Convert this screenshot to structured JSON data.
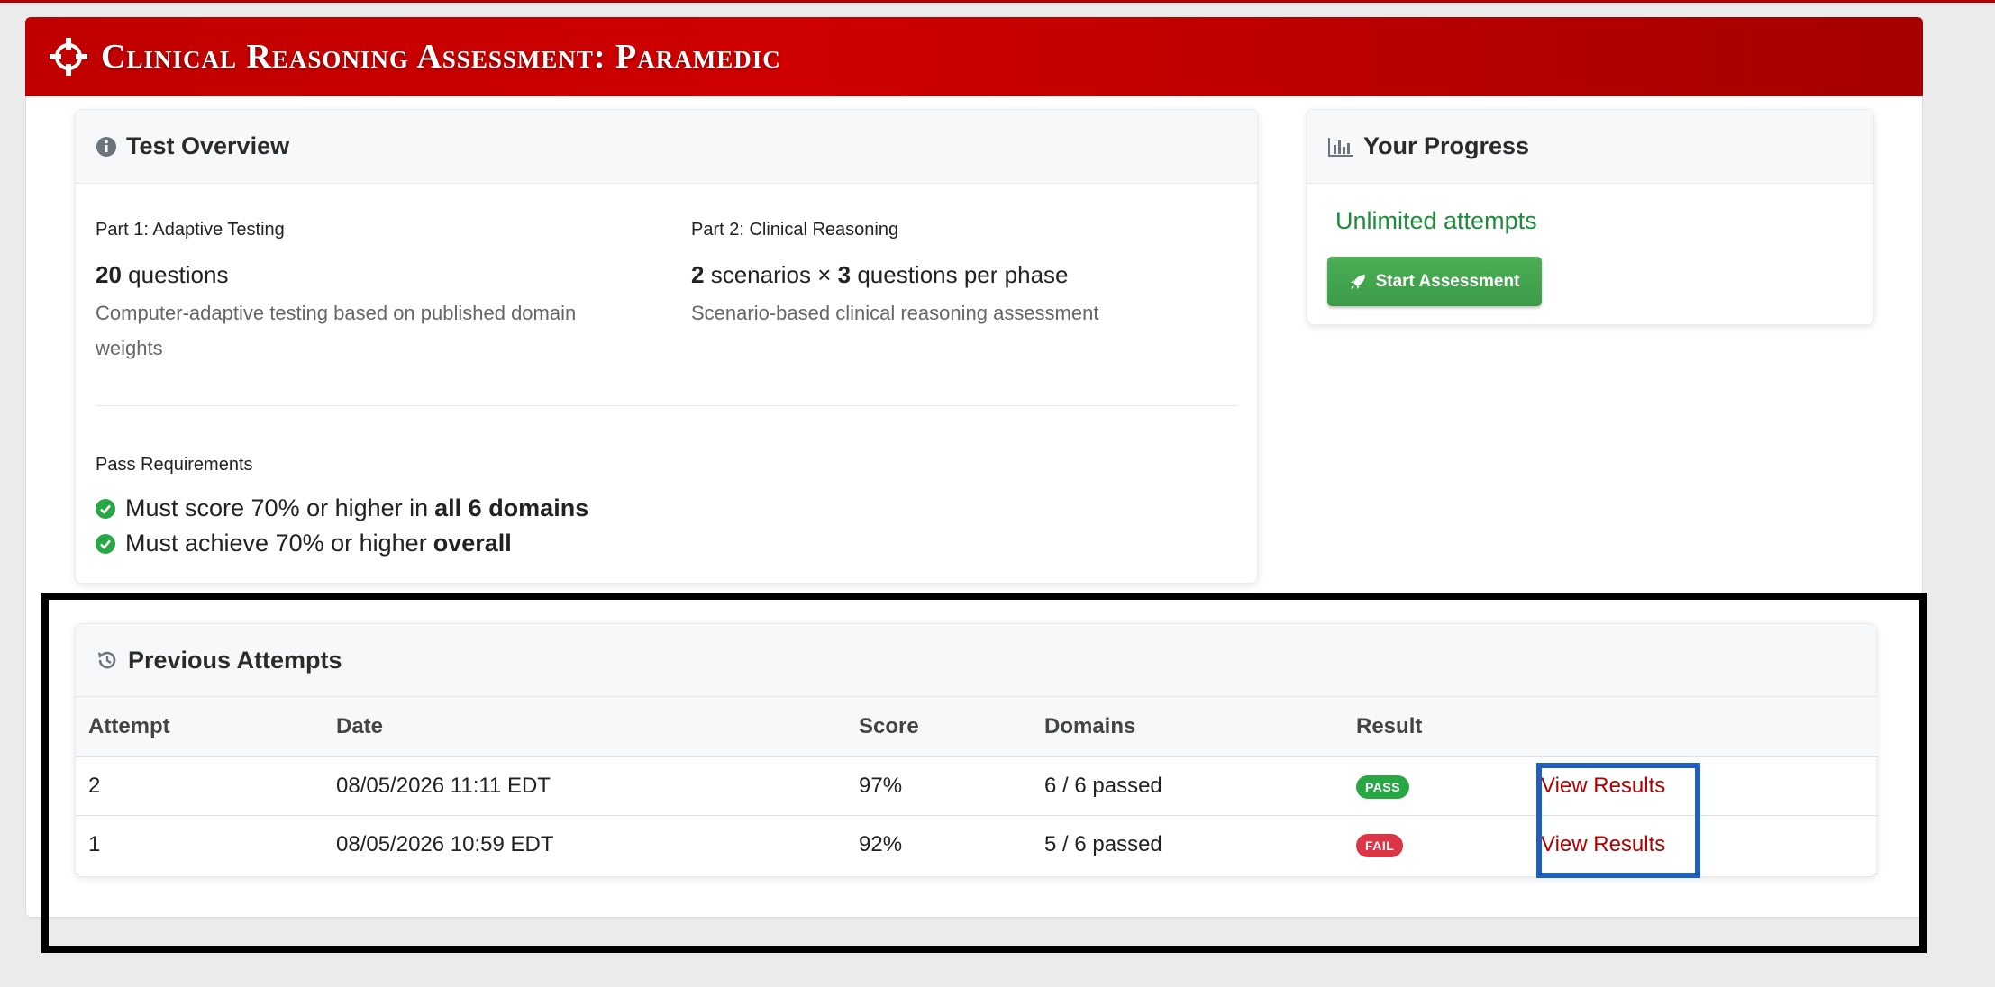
{
  "header": {
    "title": "Clinical Reasoning Assessment: Paramedic"
  },
  "overview": {
    "title": "Test Overview",
    "part1": {
      "label": "Part 1: Adaptive Testing",
      "count": "20",
      "count_suffix": "questions",
      "description": "Computer-adaptive testing based on published domain weights"
    },
    "part2": {
      "label": "Part 2: Clinical Reasoning",
      "scenarios": "2",
      "scenarios_text": "scenarios ×",
      "questions": "3",
      "questions_text": "questions per phase",
      "description": "Scenario-based clinical reasoning assessment"
    },
    "pass": {
      "label": "Pass Requirements",
      "req1_text": "Must score 70% or higher in",
      "req1_bold": "all 6 domains",
      "req2_text": "Must achieve 70% or higher",
      "req2_bold": "overall"
    }
  },
  "progress": {
    "title": "Your Progress",
    "attempts_text": "Unlimited attempts",
    "start_button": "Start Assessment"
  },
  "attempts": {
    "title": "Previous Attempts",
    "columns": [
      "Attempt",
      "Date",
      "Score",
      "Domains",
      "Result",
      ""
    ],
    "rows": [
      {
        "attempt": "2",
        "date": "08/05/2026 11:11 EDT",
        "score": "97%",
        "domains": "6 / 6 passed",
        "result": "PASS",
        "link": "View Results"
      },
      {
        "attempt": "1",
        "date": "08/05/2026 10:59 EDT",
        "score": "92%",
        "domains": "5 / 6 passed",
        "result": "FAIL",
        "link": "View Results"
      }
    ]
  },
  "colors": {
    "brand": "#c00000",
    "pass": "#28a745",
    "fail": "#dc3545",
    "link": "#b00000"
  }
}
